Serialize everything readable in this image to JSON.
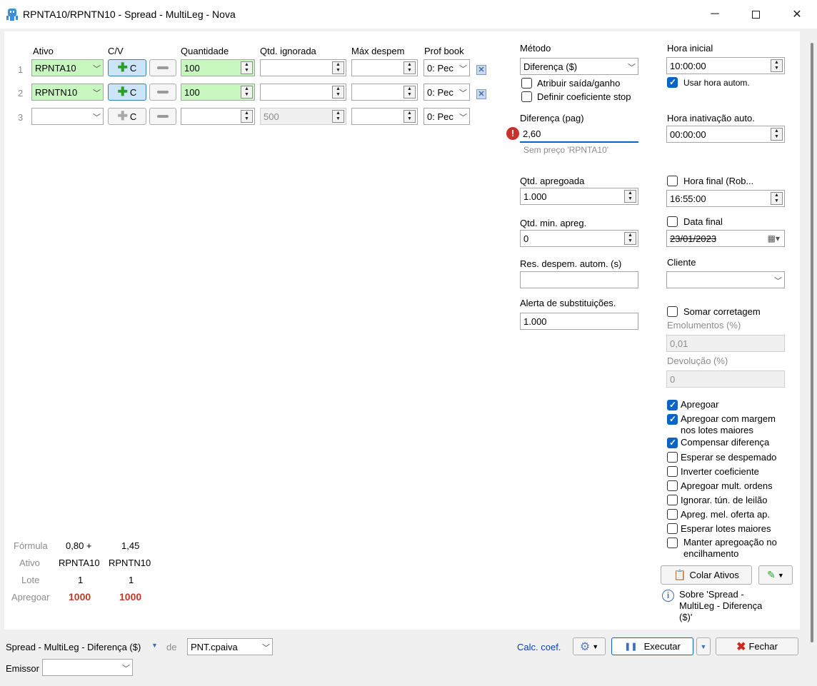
{
  "window": {
    "title": "RPNTA10/RPNTN10 - Spread - MultiLeg - Nova"
  },
  "legs": {
    "headers": {
      "ativo": "Ativo",
      "cv": "C/V",
      "quantidade": "Quantidade",
      "qtd_ignorada": "Qtd. ignorada",
      "max_desperd": "Máx despem",
      "prof_book": "Prof book"
    },
    "rows": [
      {
        "num": "1",
        "ativo": "RPNTA10",
        "cv": "C",
        "quantidade": "100",
        "qtd_ignorada": "",
        "max_desperd": "",
        "prof_book": "0: Pec"
      },
      {
        "num": "2",
        "ativo": "RPNTN10",
        "cv": "C",
        "quantidade": "100",
        "qtd_ignorada": "",
        "max_desperd": "",
        "prof_book": "0: Pec"
      },
      {
        "num": "3",
        "ativo": "",
        "cv": "C",
        "quantidade": "",
        "qtd_ignorada": "500",
        "max_desperd": "",
        "prof_book": "0: Pec"
      }
    ]
  },
  "summary": {
    "formula_label": "Fórmula",
    "formula": [
      "0,80 +",
      "1,45"
    ],
    "ativo_label": "Ativo",
    "ativos": [
      "RPNTA10",
      "RPNTN10"
    ],
    "lote_label": "Lote",
    "lotes": [
      "1",
      "1"
    ],
    "apregoar_label": "Apregoar",
    "apregoar": [
      "1000",
      "1000"
    ]
  },
  "middle": {
    "metodo_label": "Método",
    "metodo_value": "Diferença ($)",
    "atribuir_label": "Atribuir saída/ganho",
    "definir_label": "Definir coeficiente stop",
    "diferenca_label": "Diferença (pag)",
    "diferenca_value": "2,60",
    "sem_preco": "Sem preço 'RPNTA10'",
    "qtd_apregoada_label": "Qtd. apregoada",
    "qtd_apregoada_value": "1.000",
    "qtd_min_label": "Qtd. min. apreg.",
    "qtd_min_value": "0",
    "res_desperd_label": "Res. despem. autom. (s)",
    "res_desperd_value": "",
    "alerta_label": "Alerta de substituições.",
    "alerta_value": "1.000"
  },
  "right": {
    "hora_inicial_label": "Hora inicial",
    "hora_inicial_value": "10:00:00",
    "usar_hora_label": "Usar hora autom.",
    "hora_inativacao_label": "Hora inativação auto.",
    "hora_inativacao_value": "00:00:00",
    "hora_final_label": "Hora final (Rob...",
    "hora_final_value": "16:55:00",
    "data_final_label": "Data final",
    "data_final_value": "23/01/2023",
    "cliente_label": "Cliente",
    "cliente_value": "",
    "somar_label": "Somar corretagem",
    "emolumentos_label": "Emolumentos (%)",
    "emolumentos_value": "0,01",
    "devolucao_label": "Devolução (%)",
    "devolucao_value": "0",
    "options": [
      {
        "label": "Apregoar",
        "checked": true
      },
      {
        "label": "Apregoar com margem",
        "label2": "nos lotes maiores",
        "checked": true
      },
      {
        "label": "Compensar diferença",
        "checked": true
      },
      {
        "label": "Esperar se despemado",
        "checked": false
      },
      {
        "label": "Inverter coeficiente",
        "checked": false
      },
      {
        "label": "Apregoar mult. ordens",
        "checked": false
      },
      {
        "label": "Ignorar. tún. de leilão",
        "checked": false
      },
      {
        "label": "Apreg. mel. oferta ap.",
        "checked": false
      },
      {
        "label": "Esperar lotes maiores",
        "checked": false
      },
      {
        "label": "Manter apregoação no",
        "label2": "encilhamento",
        "checked": false
      }
    ],
    "colar_ativos_label": "Colar Ativos",
    "sobre_label": "Sobre 'Spread - MultiLeg - Diferença ($)'",
    "sobre_lines": [
      "Sobre 'Spread -",
      "MultiLeg - Diferença",
      "($)'"
    ]
  },
  "statusbar": {
    "strategy": "Spread - MultiLeg - Diferença ($)",
    "de_label": "de",
    "account": "PNT.cpaiva",
    "calc_coef": "Calc. coef.",
    "executar": "Executar",
    "fechar": "Fechar",
    "emissor_label": "Emissor",
    "emissor_value": ""
  },
  "colors": {
    "accent": "#0a64c8",
    "green_field": "#c8f7c0",
    "apregoar_red": "#c0392b"
  }
}
